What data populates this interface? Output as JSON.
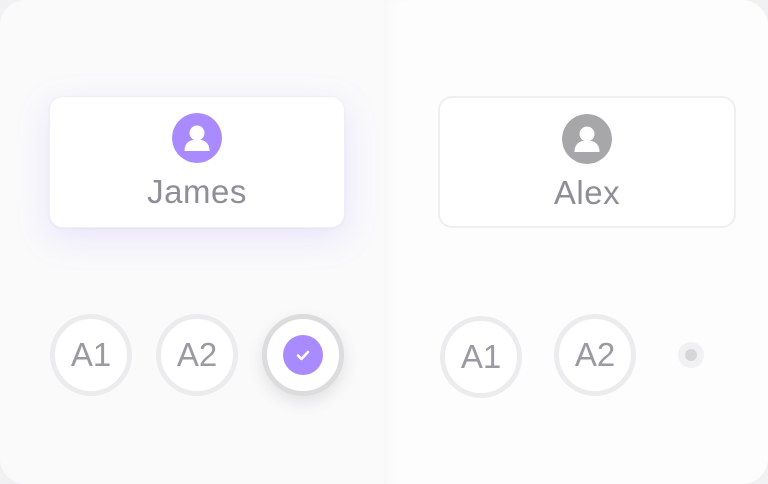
{
  "players": [
    {
      "name": "James",
      "avatar_icon": "user-icon",
      "avatar_color": "#a98bff",
      "options": [
        {
          "label": "A1",
          "state": "unselected"
        },
        {
          "label": "A2",
          "state": "unselected"
        },
        {
          "label": "",
          "state": "selected",
          "icon": "check-icon"
        }
      ]
    },
    {
      "name": "Alex",
      "avatar_icon": "user-icon",
      "avatar_color": "#a7a7aa",
      "options": [
        {
          "label": "A1",
          "state": "unselected"
        },
        {
          "label": "A2",
          "state": "unselected"
        },
        {
          "label": "",
          "state": "indicator-dot"
        }
      ]
    }
  ],
  "colors": {
    "accent": "#a98bff",
    "text": "#8e8e96",
    "chip_border": "#ececee"
  }
}
